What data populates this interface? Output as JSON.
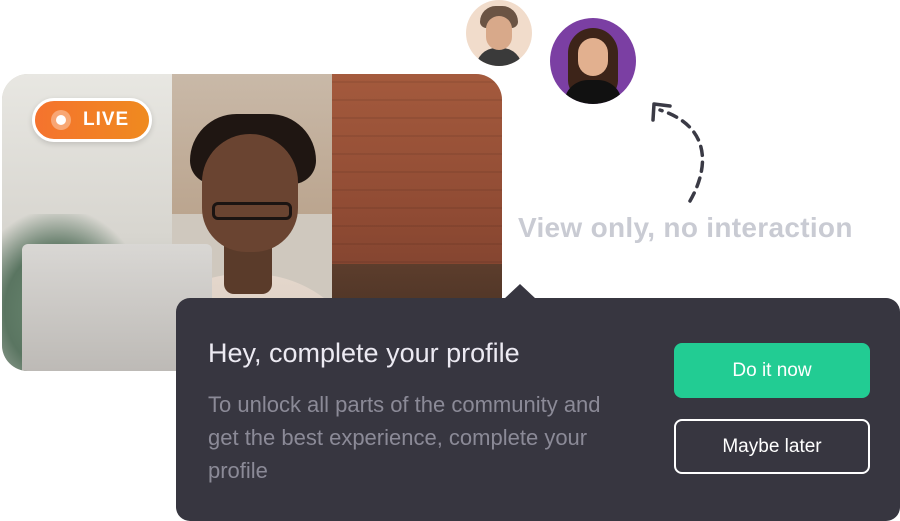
{
  "video": {
    "live_label": "LIVE"
  },
  "avatars": [
    {
      "name": "participant-avatar-1"
    },
    {
      "name": "participant-avatar-2"
    }
  ],
  "annotation": {
    "text": "View only, no interaction"
  },
  "prompt": {
    "title": "Hey, complete your profile",
    "body": "To unlock all parts of the community and get the best experience, complete your profile",
    "primary_button": "Do it now",
    "secondary_button": "Maybe later"
  },
  "colors": {
    "live_badge": "#f5732e",
    "tooltip_bg": "#373640",
    "primary_button": "#22cc93",
    "annotation_text": "#c9cbd3"
  },
  "icons": {
    "arrow": "dashed-curved-arrow-icon",
    "live_indicator": "live-dot-icon"
  }
}
